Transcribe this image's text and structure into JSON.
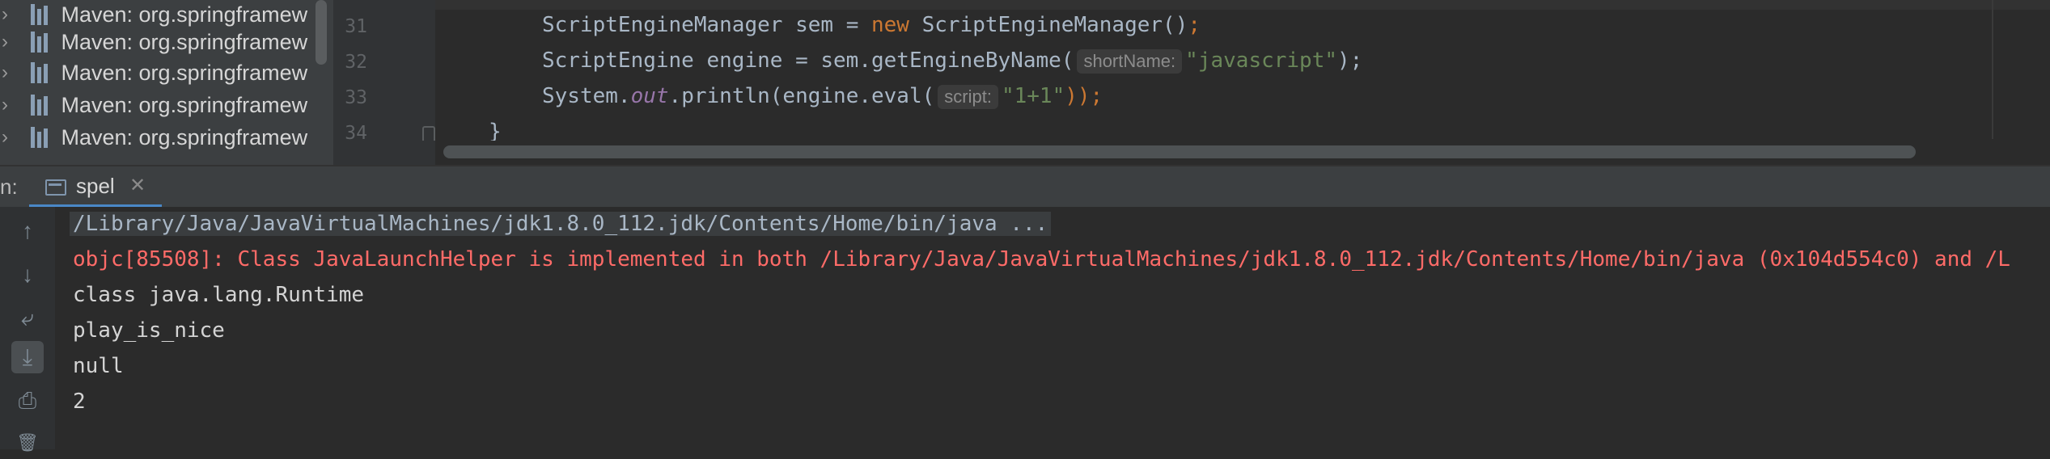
{
  "project_tree": {
    "items": [
      {
        "label": "Maven: org.springframew"
      },
      {
        "label": "Maven: org.springframew"
      },
      {
        "label": "Maven: org.springframew"
      },
      {
        "label": "Maven: org.springframew"
      },
      {
        "label": "Maven: org.springframew"
      }
    ],
    "icon": "library-icon"
  },
  "editor": {
    "line_numbers": [
      "31",
      "32",
      "33",
      "34"
    ],
    "lines": {
      "l31": {
        "type": "ScriptEngineManager",
        "var": " sem = ",
        "kw": "new",
        "ctor": " ScriptEngineManager()",
        "semi": ";"
      },
      "l32": {
        "pre": "ScriptEngine engine = sem.getEngineByName(",
        "hint": "shortName:",
        "str": "\"javascript\"",
        "post": ");"
      },
      "l33": {
        "pre": "System.",
        "field": "out",
        "mid": ".println(engine.eval(",
        "hint": "script:",
        "str": "\"1+1\"",
        "post": "));"
      },
      "l34": {
        "text": "}"
      }
    }
  },
  "run_window": {
    "label": "n:",
    "tab": {
      "label": "spel",
      "close": "✕"
    }
  },
  "console": {
    "toolbar": [
      {
        "icon": "up-arrow-icon",
        "glyph": "↑"
      },
      {
        "icon": "down-arrow-icon",
        "glyph": "↓"
      },
      {
        "icon": "soft-wrap-icon",
        "glyph": "⤶"
      },
      {
        "icon": "scroll-to-end-icon",
        "glyph": "⤓"
      },
      {
        "icon": "print-icon",
        "glyph": "⎙"
      },
      {
        "icon": "trash-icon",
        "glyph": "🗑"
      }
    ],
    "lines": [
      {
        "kind": "cmd",
        "text": "/Library/Java/JavaVirtualMachines/jdk1.8.0_112.jdk/Contents/Home/bin/java ..."
      },
      {
        "kind": "err",
        "text": "objc[85508]: Class JavaLaunchHelper is implemented in both /Library/Java/JavaVirtualMachines/jdk1.8.0_112.jdk/Contents/Home/bin/java (0x104d554c0) and /L"
      },
      {
        "kind": "out",
        "text": "class java.lang.Runtime"
      },
      {
        "kind": "out",
        "text": "play_is_nice"
      },
      {
        "kind": "out",
        "text": "null"
      },
      {
        "kind": "out",
        "text": "2"
      }
    ]
  },
  "colors": {
    "keyword": "#cc7832",
    "string": "#6a8759",
    "field": "#9876aa",
    "error": "#ff6b68",
    "tab_underline": "#4a88c7"
  }
}
